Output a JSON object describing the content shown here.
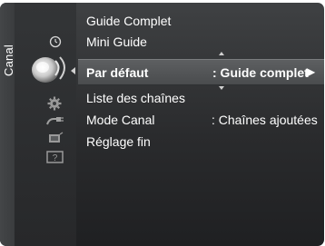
{
  "sidebar": {
    "label": "Canal",
    "icons": [
      "clock-icon",
      "channel-satellite-icon",
      "gear-icon",
      "input-plug-icon",
      "application-icon",
      "help-icon"
    ]
  },
  "menu": {
    "items": [
      {
        "label": "Guide Complet"
      },
      {
        "label": "Mini Guide"
      },
      {
        "label": "Par défaut",
        "value": ": Guide complet",
        "arrow": "▶"
      },
      {
        "label": "Liste des chaînes"
      },
      {
        "label": "Mode Canal",
        "value": ": Chaînes ajoutées"
      },
      {
        "label": "Réglage fin"
      }
    ],
    "selected_index": 2
  }
}
